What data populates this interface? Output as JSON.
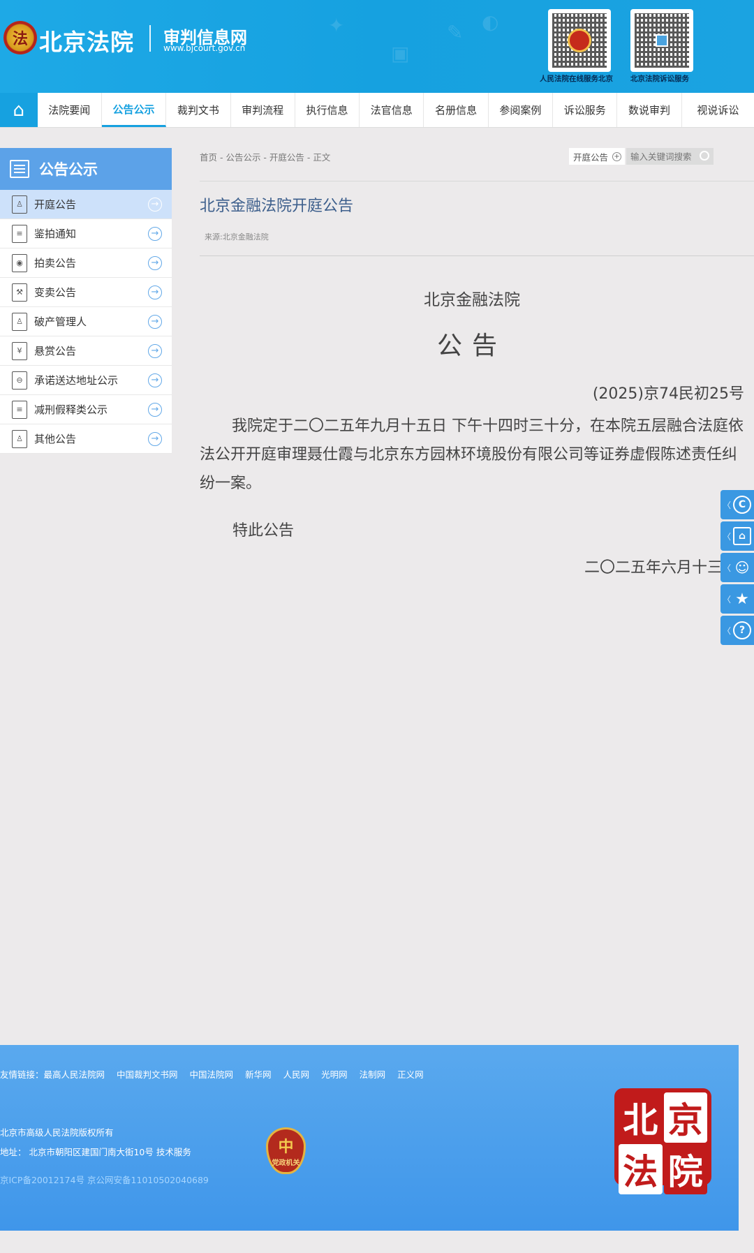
{
  "header": {
    "site_name": "北京法院",
    "site_sub": "审判信息网",
    "site_url": "www.bjcourt.gov.cn",
    "qr1_caption": "人民法院在线服务北京",
    "qr2_caption": "北京法院诉讼服务"
  },
  "nav": {
    "items": [
      "法院要闻",
      "公告公示",
      "裁判文书",
      "审判流程",
      "执行信息",
      "法官信息",
      "名册信息",
      "参阅案例",
      "诉讼服务",
      "数说审判",
      "视说诉讼"
    ],
    "active_index": 1
  },
  "sidebar": {
    "title": "公告公示",
    "items": [
      {
        "label": "开庭公告",
        "active": true
      },
      {
        "label": "鉴拍通知"
      },
      {
        "label": "拍卖公告"
      },
      {
        "label": "变卖公告"
      },
      {
        "label": "破产管理人"
      },
      {
        "label": "悬赏公告"
      },
      {
        "label": "承诺送达地址公示"
      },
      {
        "label": "减刑假释类公示"
      },
      {
        "label": "其他公告"
      }
    ]
  },
  "main": {
    "breadcrumb": "首页 - 公告公示 - 开庭公告 - 正文",
    "search_tag": "开庭公告",
    "search_placeholder": "输入关键词搜索",
    "title": "北京金融法院开庭公告",
    "source": "来源:北京金融法院",
    "org": "北京金融法院",
    "notice": "公告",
    "case_no": "(2025)京74民初25号",
    "body": "我院定于二〇二五年九月十五日 下午十四时三十分，在本院五层融合法庭依法公开开庭审理聂仕霞与北京东方园林环境股份有限公司等证券虚假陈述责任纠纷一案。",
    "closing": "特此公告",
    "date": "二〇二五年六月十三"
  },
  "float_bar": {
    "icons": [
      "copyright-icon",
      "home-icon",
      "user-icon",
      "star-icon",
      "help-icon"
    ]
  },
  "footer": {
    "links_label": "友情链接：",
    "links": [
      "最高人民法院网",
      "中国裁判文书网",
      "中国法院网",
      "新华网",
      "人民网",
      "光明网",
      "法制网",
      "正义网"
    ],
    "copyright": "北京市高级人民法院版权所有",
    "address": "地址：  北京市朝阳区建国门南大街10号 技术服务",
    "icp": "京ICP备20012174号 京公网安备11010502040689",
    "badge_text": "党政机关",
    "logo_chars": [
      "北",
      "京",
      "法",
      "院"
    ]
  },
  "colors": {
    "header_blue": "#1ea9e6",
    "sidebar_head": "#5ca2e8",
    "title_blue": "#3d5f8c",
    "footer_blue": "#4a9eec",
    "logo_red": "#c11b1b"
  }
}
